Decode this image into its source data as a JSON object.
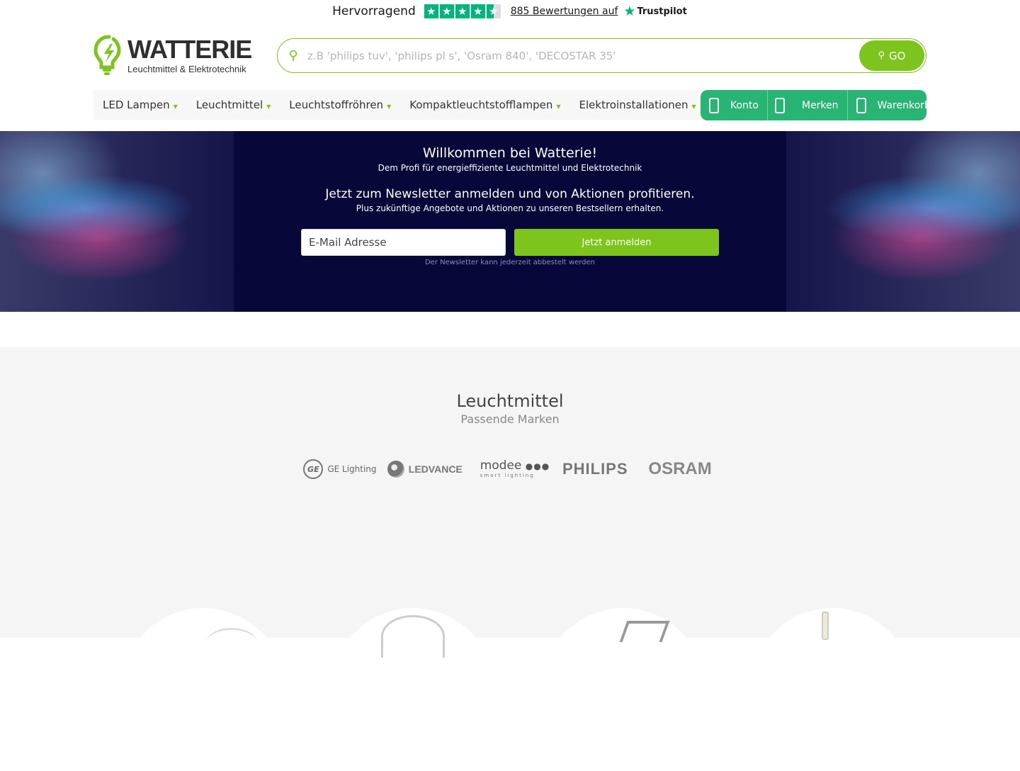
{
  "trustpilot": {
    "rating_label": "Hervorragend",
    "reviews_link": "885 Bewertungen auf",
    "brand": "Trustpilot",
    "stars": 4.5
  },
  "header": {
    "logo_name": "WATTERIE",
    "logo_subtitle": "Leuchtmittel & Elektrotechnik",
    "search_placeholder": "z.B 'philips tuv', 'philips pl s', 'Osram 840', 'DECOSTAR 35'",
    "search_button": "GO"
  },
  "nav": {
    "items": [
      {
        "label": "LED Lampen"
      },
      {
        "label": "Leuchtmittel"
      },
      {
        "label": "Leuchtstoffröhren"
      },
      {
        "label": "Kompaktleuchtstofflampen"
      },
      {
        "label": "Elektroinstallationen"
      }
    ]
  },
  "account": {
    "konto": "Konto",
    "merken": "Merken",
    "warenkorb": "Warenkorb"
  },
  "hero": {
    "title": "Willkommen bei Watterie!",
    "subtitle": "Dem Profi für energieffiziente Leuchtmittel und Elektrotechnik",
    "newsletter_title": "Jetzt zum Newsletter anmelden und von Aktionen profitieren.",
    "newsletter_subtitle": "Plus zukünftige Angebote und Aktionen zu unseren Bestsellern erhalten.",
    "email_placeholder": "E-Mail Adresse",
    "submit_label": "Jetzt anmelden",
    "note": "Der Newsletter kann jederzeit abbestelt werden"
  },
  "brands": {
    "title": "Leuchtmittel",
    "subtitle": "Passende Marken",
    "items": [
      {
        "name": "GE Lighting"
      },
      {
        "name": "LEDVANCE"
      },
      {
        "name": "modee",
        "tagline": "smart lighting"
      },
      {
        "name": "PHILIPS"
      },
      {
        "name": "OSRAM"
      }
    ]
  },
  "colors": {
    "accent_green": "#7dc41c",
    "account_green": "#28b473",
    "trustpilot_green": "#00b67a",
    "hero_bg": "#07073a"
  }
}
